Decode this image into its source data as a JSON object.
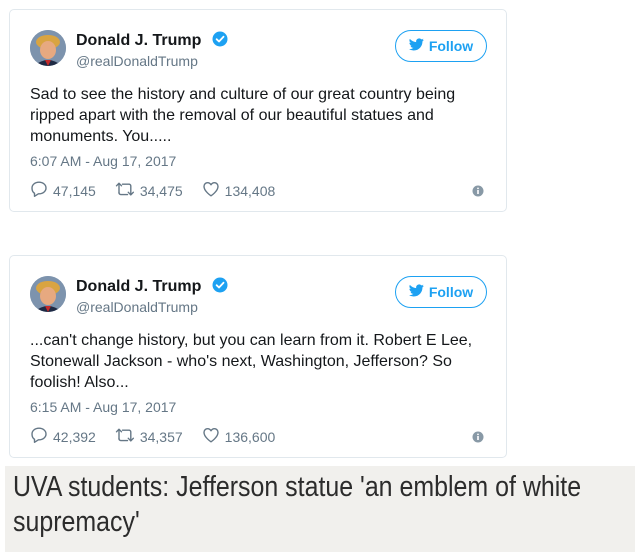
{
  "tweets": [
    {
      "author_name": "Donald J. Trump",
      "handle": "@realDonaldTrump",
      "follow_label": "Follow",
      "text": "Sad to see the history and culture of our great country being ripped apart with the removal of our beautiful statues and monuments. You.....",
      "timestamp": "6:07 AM - Aug 17, 2017",
      "replies": "47,145",
      "retweets": "34,475",
      "likes": "134,408"
    },
    {
      "author_name": "Donald J. Trump",
      "handle": "@realDonaldTrump",
      "follow_label": "Follow",
      "text": "...can't change history, but you can learn from it. Robert E Lee, Stonewall Jackson - who's next, Washington, Jefferson? So foolish! Also...",
      "timestamp": "6:15 AM - Aug 17, 2017",
      "replies": "42,392",
      "retweets": "34,357",
      "likes": "136,600"
    }
  ],
  "headline": "UVA students: Jefferson statue 'an emblem of white supremacy'",
  "colors": {
    "twitter_blue": "#1da1f2",
    "muted_text": "#657786",
    "border": "#e1e8ed",
    "headline_background": "#f1f0ed"
  },
  "icons": {
    "verified": "verified-badge-icon",
    "follow": "twitter-bird-icon",
    "reply": "reply-icon",
    "retweet": "retweet-icon",
    "like": "heart-icon",
    "info": "info-icon"
  }
}
